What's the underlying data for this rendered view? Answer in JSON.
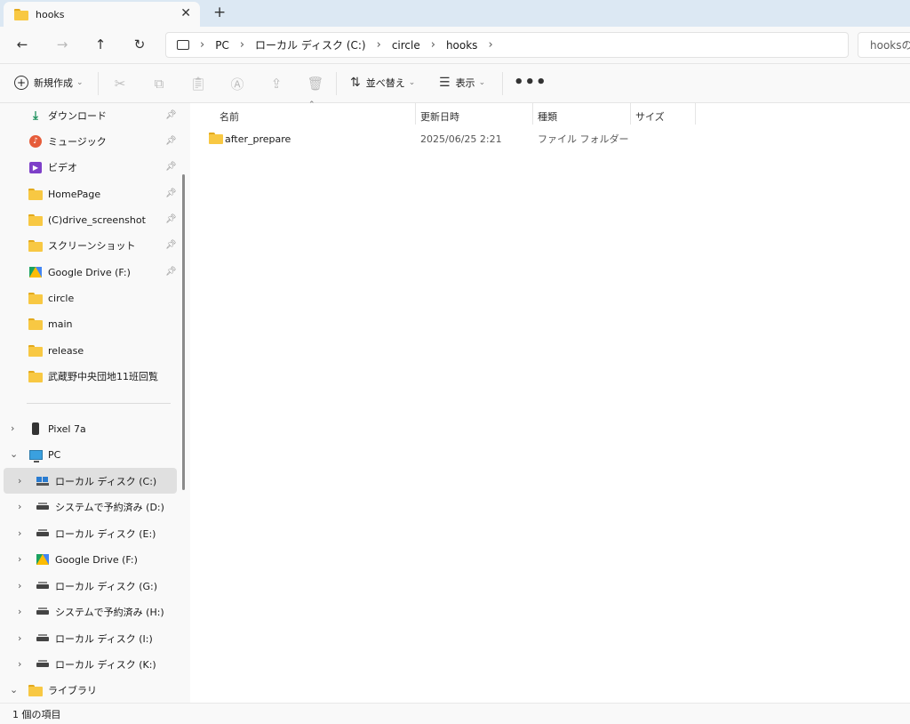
{
  "tab": {
    "title": "hooks",
    "close_glyph": "✕",
    "new_tab_glyph": "+"
  },
  "nav": {
    "back_glyph": "←",
    "forward_glyph": "→",
    "up_glyph": "↑",
    "refresh_glyph": "↻",
    "breadcrumb": [
      "PC",
      "ローカル ディスク (C:)",
      "circle",
      "hooks"
    ],
    "search_placeholder": "hooksの検索"
  },
  "toolbar": {
    "new_label": "新規作成",
    "sort_label": "並べ替え",
    "view_label": "表示",
    "more_glyph": "•••"
  },
  "sidebar": {
    "quick_access": [
      {
        "label": "ダウンロード",
        "icon": "download-icon",
        "pinned": true
      },
      {
        "label": "ミュージック",
        "icon": "music-icon",
        "pinned": true
      },
      {
        "label": "ビデオ",
        "icon": "video-icon",
        "pinned": true
      },
      {
        "label": "HomePage",
        "icon": "folder-icon",
        "pinned": true
      },
      {
        "label": "(C)drive_screenshot",
        "icon": "folder-icon",
        "pinned": true
      },
      {
        "label": "スクリーンショット",
        "icon": "folder-icon",
        "pinned": true
      },
      {
        "label": "Google Drive (F:)",
        "icon": "google-drive-icon",
        "pinned": true
      },
      {
        "label": "circle",
        "icon": "folder-icon",
        "pinned": false
      },
      {
        "label": "main",
        "icon": "folder-icon",
        "pinned": false
      },
      {
        "label": "release",
        "icon": "folder-icon",
        "pinned": false
      },
      {
        "label": "武蔵野中央団地11班回覧",
        "icon": "folder-icon",
        "pinned": false
      }
    ],
    "devices": [
      {
        "label": "Pixel 7a",
        "icon": "phone-icon"
      },
      {
        "label": "PC",
        "icon": "pc-icon"
      }
    ],
    "drives": [
      {
        "label": "ローカル ディスク (C:)",
        "icon": "windows-drive-icon",
        "selected": true
      },
      {
        "label": "システムで予約済み (D:)",
        "icon": "drive-icon"
      },
      {
        "label": "ローカル ディスク (E:)",
        "icon": "drive-icon"
      },
      {
        "label": "Google Drive (F:)",
        "icon": "google-drive-icon"
      },
      {
        "label": "ローカル ディスク (G:)",
        "icon": "drive-icon"
      },
      {
        "label": "システムで予約済み (H:)",
        "icon": "drive-icon"
      },
      {
        "label": "ローカル ディスク (I:)",
        "icon": "drive-icon"
      },
      {
        "label": "ローカル ディスク (K:)",
        "icon": "drive-icon"
      }
    ],
    "library": {
      "label": "ライブラリ",
      "icon": "folder-icon"
    }
  },
  "columns": {
    "name": "名前",
    "modified": "更新日時",
    "type": "種類",
    "size": "サイズ"
  },
  "files": [
    {
      "name": "after_prepare",
      "modified": "2025/06/25 2:21",
      "type": "ファイル フォルダー",
      "size": ""
    }
  ],
  "status": {
    "item_count": "1 個の項目"
  }
}
